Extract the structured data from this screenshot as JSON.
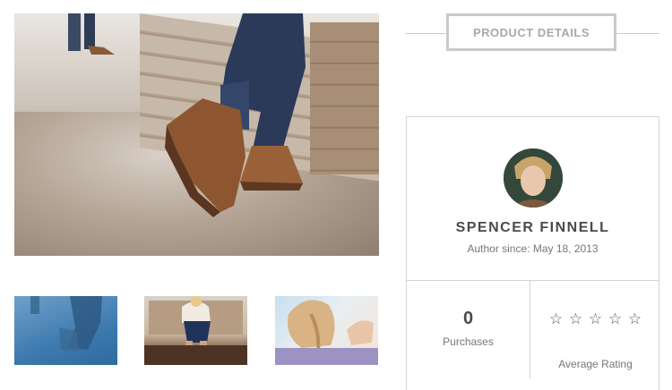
{
  "gallery": {
    "main_image": "photo-brown-boots-on-concrete-floor",
    "thumbnails": [
      "photo-blue-tinted-boots",
      "photo-girl-sitting-on-steps",
      "photo-blonde-braided-hair"
    ]
  },
  "tab": {
    "label": "PRODUCT DETAILS"
  },
  "author": {
    "name": "SPENCER FINNELL",
    "since": "Author since: May 18, 2013",
    "avatar_icon": "avatar-icon"
  },
  "stats": {
    "purchases_value": "0",
    "purchases_label": "Purchases",
    "rating_label": "Average Rating",
    "rating_stars": [
      "☆",
      "☆",
      "☆",
      "☆",
      "☆"
    ],
    "rating_filled": 0,
    "rating_max": 5
  }
}
